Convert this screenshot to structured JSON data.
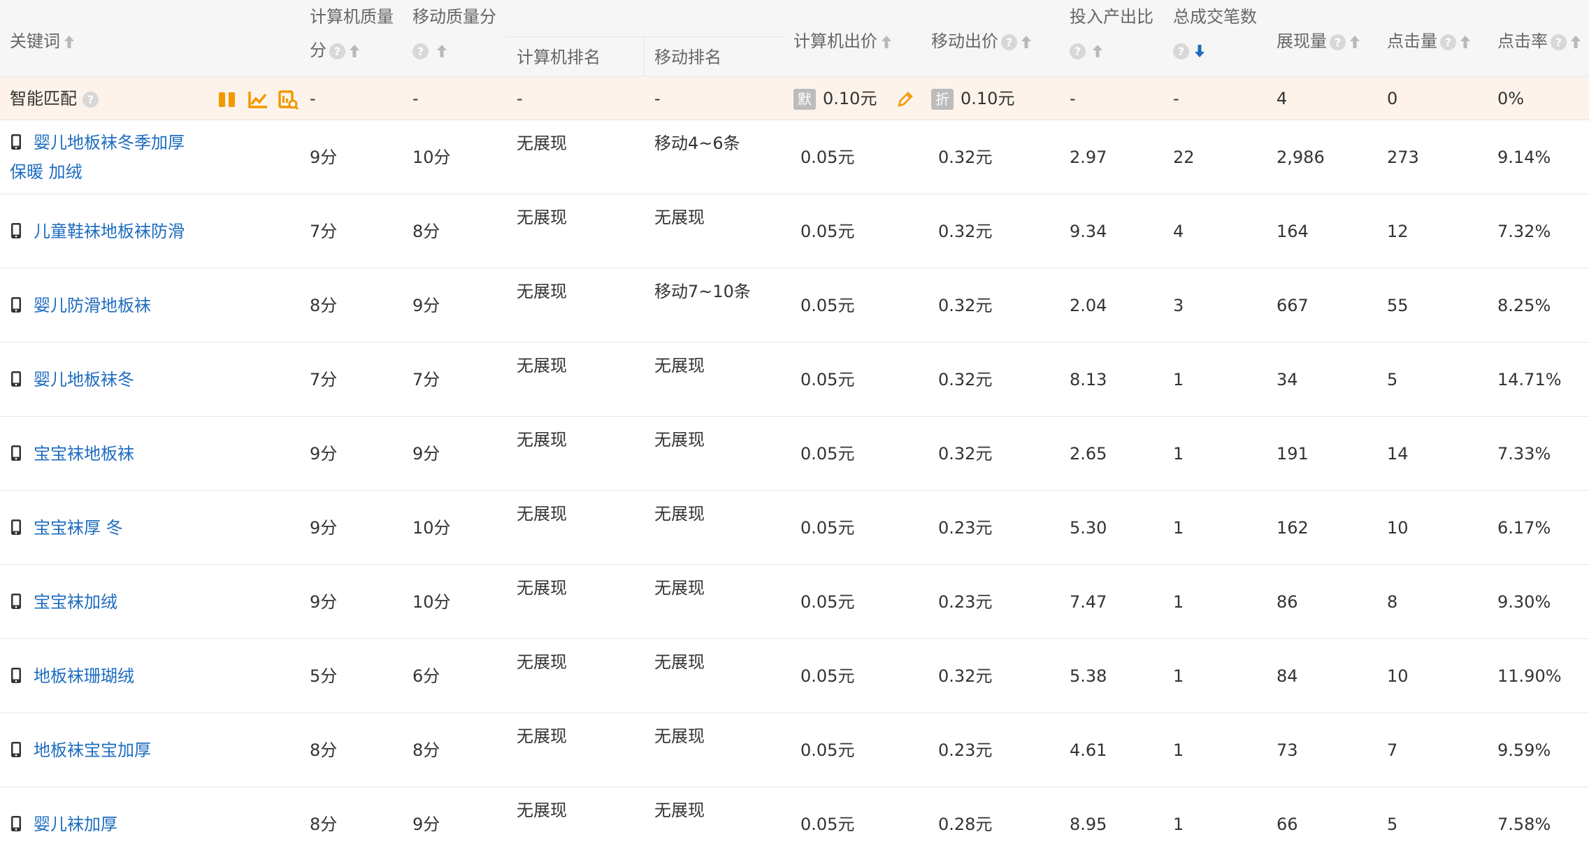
{
  "columns": {
    "keyword": "关键词",
    "pc_quality": [
      "计算机质量",
      "分"
    ],
    "mobile_quality": [
      "移动质量分"
    ],
    "pc_rank": "计算机排名",
    "mobile_rank": "移动排名",
    "pc_bid": "计算机出价",
    "mobile_bid": "移动出价",
    "roi": "投入产出比",
    "total_deals": "总成交笔数",
    "impressions": "展现量",
    "clicks": "点击量",
    "ctr": "点击率"
  },
  "help_symbol": "?",
  "smart_match": {
    "label": "智能匹配",
    "pc_quality": "-",
    "mobile_quality": "-",
    "pc_rank": "-",
    "mobile_rank": "-",
    "pc_bid_tag": "默",
    "pc_bid": "0.10元",
    "mobile_bid_tag": "折",
    "mobile_bid": "0.10元",
    "roi": "-",
    "total_deals": "-",
    "impressions": "4",
    "clicks": "0",
    "ctr": "0%"
  },
  "rows": [
    {
      "keyword": "婴儿地板袜冬季加厚保暖 加绒",
      "pc_quality": "9分",
      "mobile_quality": "10分",
      "pc_rank": "无展现",
      "mobile_rank": "移动4~6条",
      "pc_bid": "0.05元",
      "mobile_bid": "0.32元",
      "roi": "2.97",
      "total_deals": "22",
      "impressions": "2,986",
      "clicks": "273",
      "ctr": "9.14%"
    },
    {
      "keyword": "儿童鞋袜地板袜防滑",
      "pc_quality": "7分",
      "mobile_quality": "8分",
      "pc_rank": "无展现",
      "mobile_rank": "无展现",
      "pc_bid": "0.05元",
      "mobile_bid": "0.32元",
      "roi": "9.34",
      "total_deals": "4",
      "impressions": "164",
      "clicks": "12",
      "ctr": "7.32%"
    },
    {
      "keyword": "婴儿防滑地板袜",
      "pc_quality": "8分",
      "mobile_quality": "9分",
      "pc_rank": "无展现",
      "mobile_rank": "移动7~10条",
      "pc_bid": "0.05元",
      "mobile_bid": "0.32元",
      "roi": "2.04",
      "total_deals": "3",
      "impressions": "667",
      "clicks": "55",
      "ctr": "8.25%"
    },
    {
      "keyword": "婴儿地板袜冬",
      "pc_quality": "7分",
      "mobile_quality": "7分",
      "pc_rank": "无展现",
      "mobile_rank": "无展现",
      "pc_bid": "0.05元",
      "mobile_bid": "0.32元",
      "roi": "8.13",
      "total_deals": "1",
      "impressions": "34",
      "clicks": "5",
      "ctr": "14.71%"
    },
    {
      "keyword": "宝宝袜地板袜",
      "pc_quality": "9分",
      "mobile_quality": "9分",
      "pc_rank": "无展现",
      "mobile_rank": "无展现",
      "pc_bid": "0.05元",
      "mobile_bid": "0.32元",
      "roi": "2.65",
      "total_deals": "1",
      "impressions": "191",
      "clicks": "14",
      "ctr": "7.33%"
    },
    {
      "keyword": "宝宝袜厚 冬",
      "pc_quality": "9分",
      "mobile_quality": "10分",
      "pc_rank": "无展现",
      "mobile_rank": "无展现",
      "pc_bid": "0.05元",
      "mobile_bid": "0.23元",
      "roi": "5.30",
      "total_deals": "1",
      "impressions": "162",
      "clicks": "10",
      "ctr": "6.17%"
    },
    {
      "keyword": "宝宝袜加绒",
      "pc_quality": "9分",
      "mobile_quality": "10分",
      "pc_rank": "无展现",
      "mobile_rank": "无展现",
      "pc_bid": "0.05元",
      "mobile_bid": "0.23元",
      "roi": "7.47",
      "total_deals": "1",
      "impressions": "86",
      "clicks": "8",
      "ctr": "9.30%"
    },
    {
      "keyword": "地板袜珊瑚绒",
      "pc_quality": "5分",
      "mobile_quality": "6分",
      "pc_rank": "无展现",
      "mobile_rank": "无展现",
      "pc_bid": "0.05元",
      "mobile_bid": "0.32元",
      "roi": "5.38",
      "total_deals": "1",
      "impressions": "84",
      "clicks": "10",
      "ctr": "11.90%"
    },
    {
      "keyword": "地板袜宝宝加厚",
      "pc_quality": "8分",
      "mobile_quality": "8分",
      "pc_rank": "无展现",
      "mobile_rank": "无展现",
      "pc_bid": "0.05元",
      "mobile_bid": "0.23元",
      "roi": "4.61",
      "total_deals": "1",
      "impressions": "73",
      "clicks": "7",
      "ctr": "9.59%"
    },
    {
      "keyword": "婴儿袜加厚",
      "pc_quality": "8分",
      "mobile_quality": "9分",
      "pc_rank": "无展现",
      "mobile_rank": "无展现",
      "pc_bid": "0.05元",
      "mobile_bid": "0.28元",
      "roi": "8.95",
      "total_deals": "1",
      "impressions": "66",
      "clicks": "5",
      "ctr": "7.58%"
    }
  ],
  "colors": {
    "header_bg": "#f6f6f6",
    "smart_row_bg": "#fdf3ea",
    "link": "#1e6cbf",
    "accent_orange": "#f39800",
    "sort_active": "#1e6cbf"
  }
}
